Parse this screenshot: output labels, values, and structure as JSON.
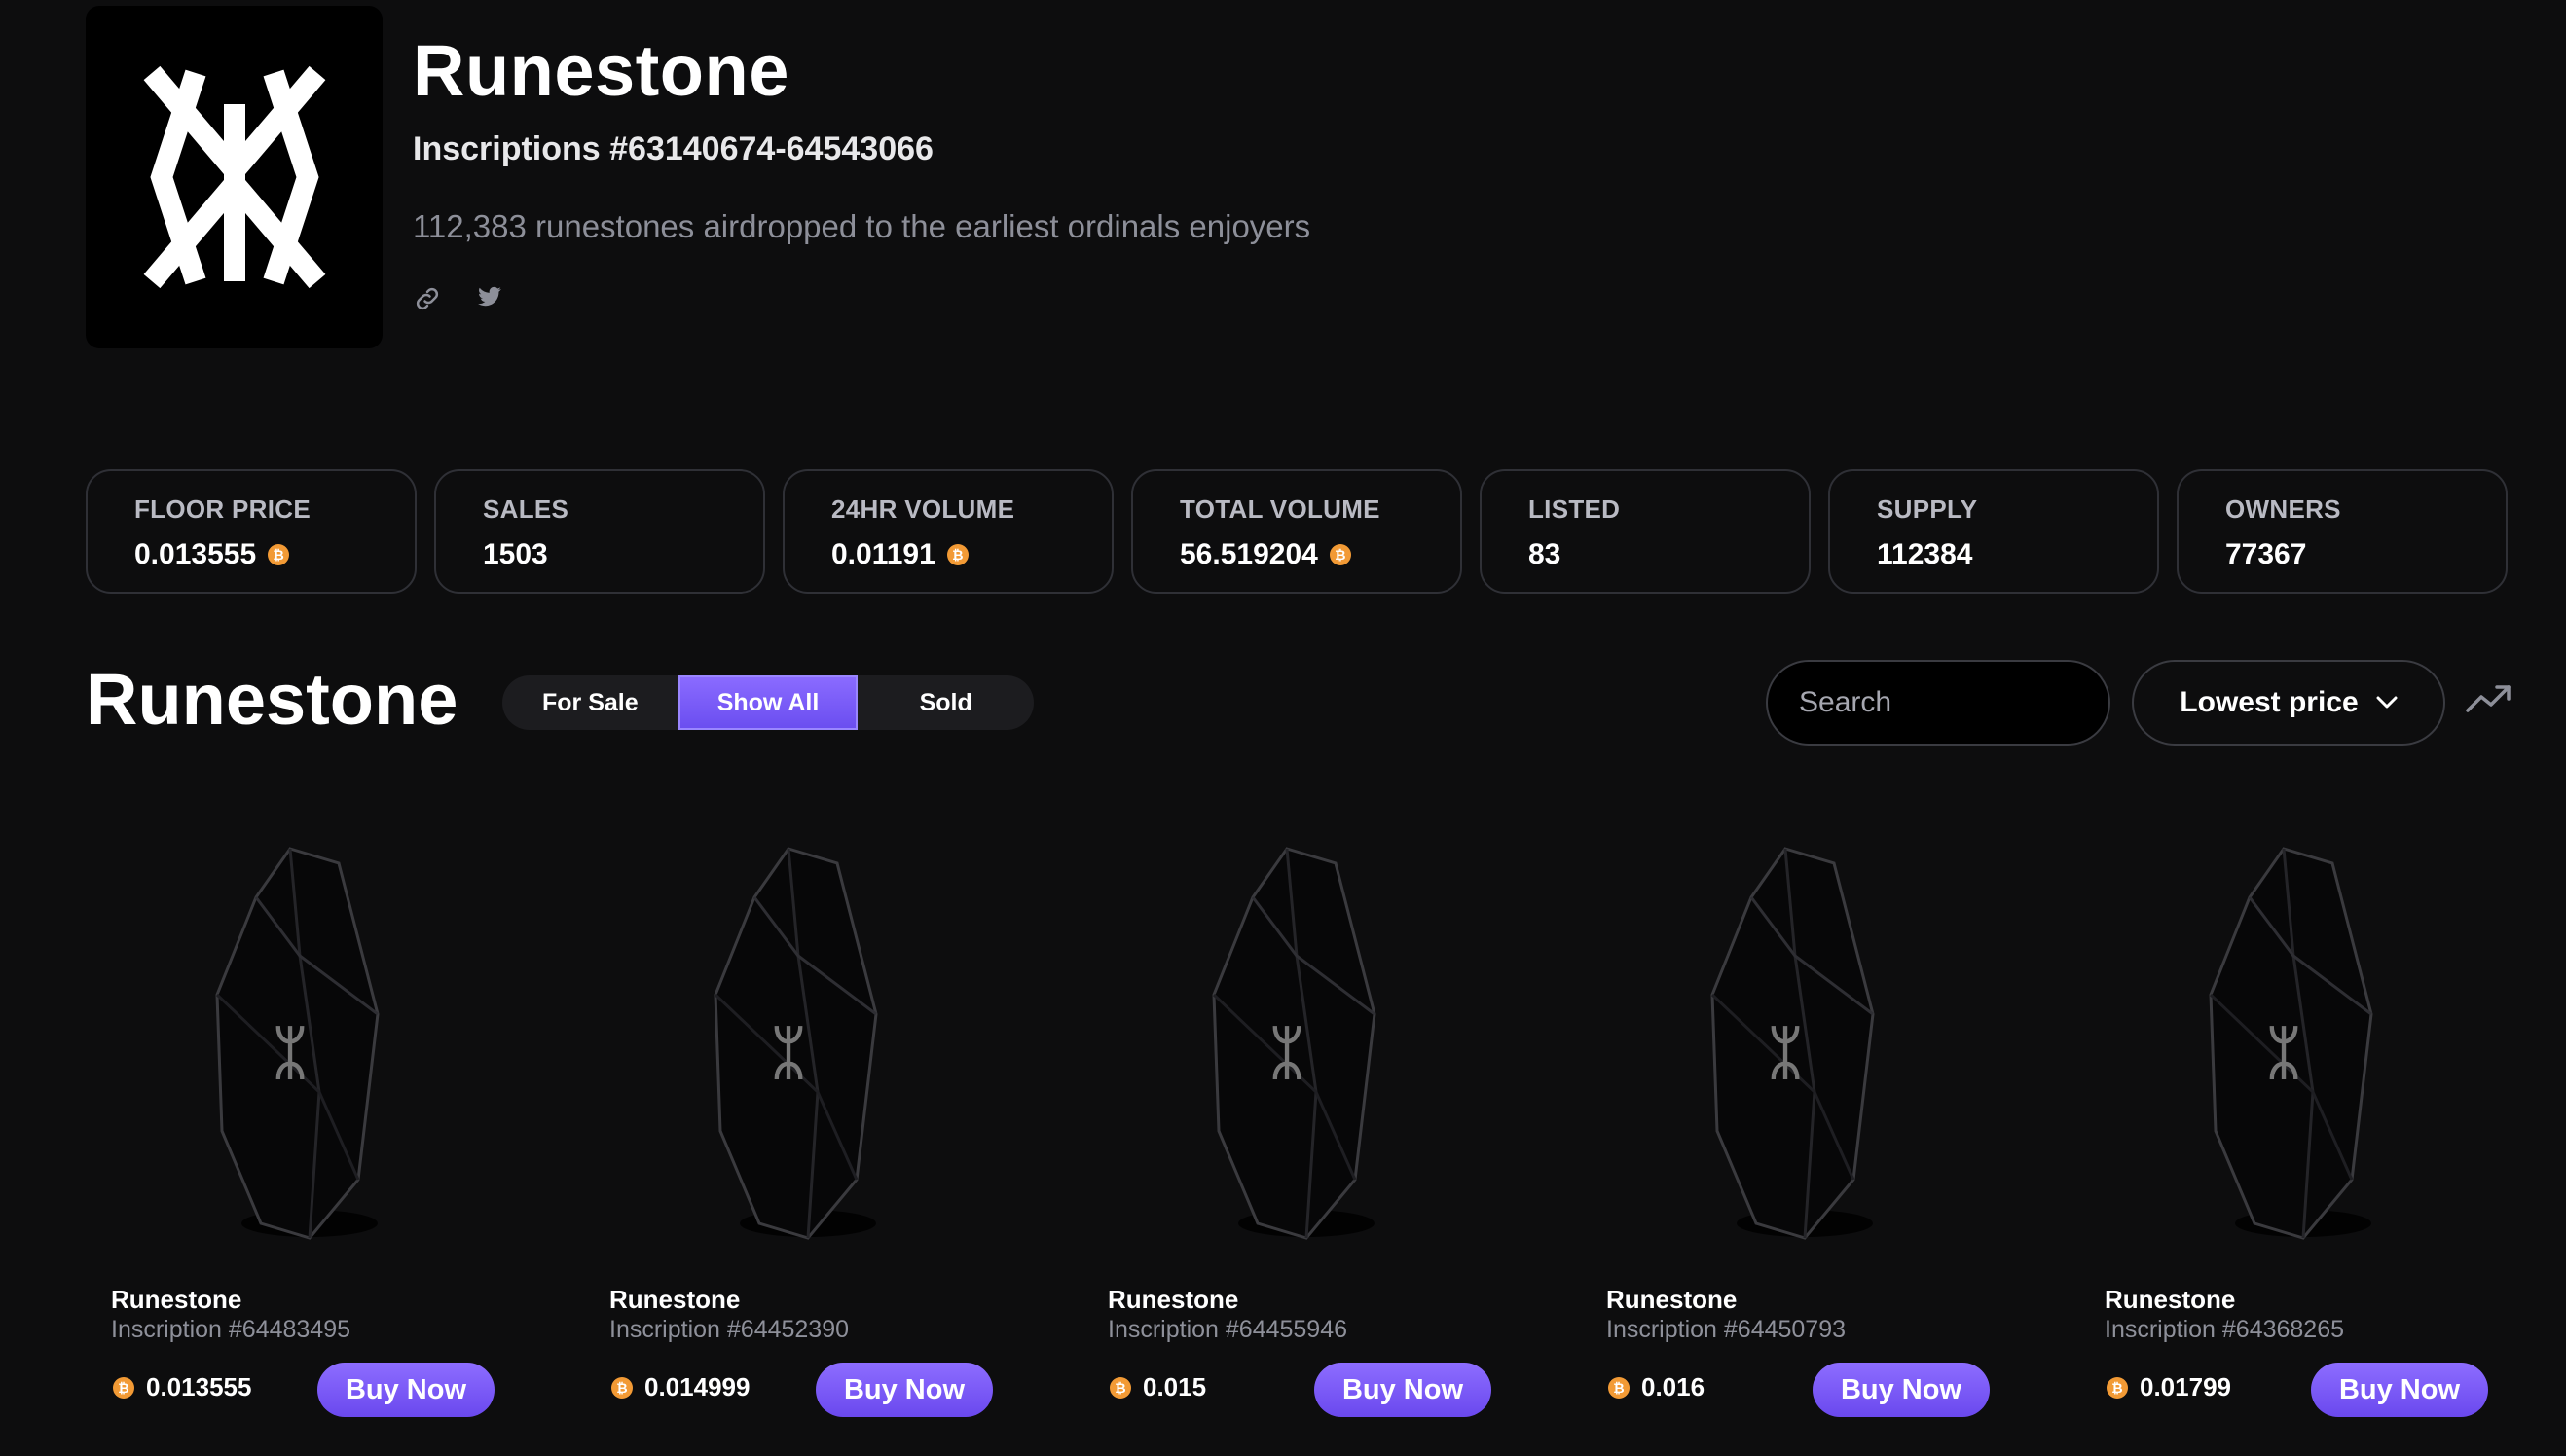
{
  "collection": {
    "title": "Runestone",
    "subtitle": "Inscriptions #63140674-64543066",
    "description": "112,383 runestones airdropped to the earliest ordinals enjoyers",
    "social": [
      "link-icon",
      "twitter-icon"
    ]
  },
  "stats": [
    {
      "label": "FLOOR PRICE",
      "value": "0.013555",
      "btc": true
    },
    {
      "label": "SALES",
      "value": "1503",
      "btc": false
    },
    {
      "label": "24HR VOLUME",
      "value": "0.01191",
      "btc": true
    },
    {
      "label": "TOTAL VOLUME",
      "value": "56.519204",
      "btc": true
    },
    {
      "label": "LISTED",
      "value": "83",
      "btc": false
    },
    {
      "label": "SUPPLY",
      "value": "112384",
      "btc": false
    },
    {
      "label": "OWNERS",
      "value": "77367",
      "btc": false
    }
  ],
  "toolbar": {
    "section_title": "Runestone",
    "filters": [
      "For Sale",
      "Show All",
      "Sold"
    ],
    "active_filter": "Show All",
    "search_placeholder": "Search",
    "sort_label": "Lowest price"
  },
  "btc_symbol": "₿",
  "accent_color": "#7b5cff",
  "btc_color": "#f29a35",
  "items": [
    {
      "name": "Runestone",
      "inscription": "Inscription #64483495",
      "price": "0.013555",
      "buy_label": "Buy Now"
    },
    {
      "name": "Runestone",
      "inscription": "Inscription #64452390",
      "price": "0.014999",
      "buy_label": "Buy Now"
    },
    {
      "name": "Runestone",
      "inscription": "Inscription #64455946",
      "price": "0.015",
      "buy_label": "Buy Now"
    },
    {
      "name": "Runestone",
      "inscription": "Inscription #64450793",
      "price": "0.016",
      "buy_label": "Buy Now"
    },
    {
      "name": "Runestone",
      "inscription": "Inscription #64368265",
      "price": "0.01799",
      "buy_label": "Buy Now"
    }
  ]
}
